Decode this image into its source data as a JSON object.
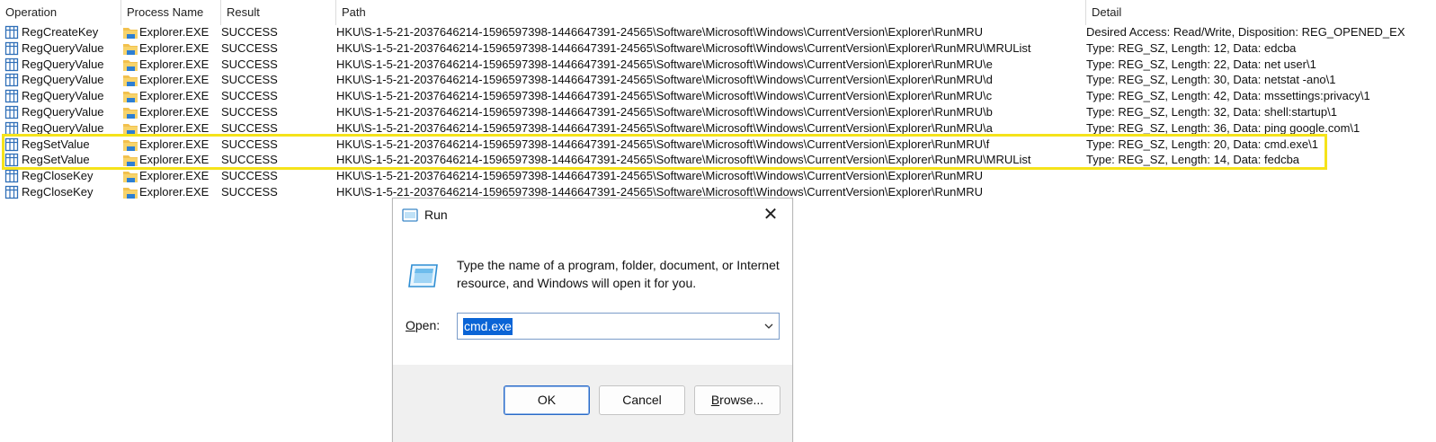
{
  "columns": {
    "operation": "Operation",
    "process_name": "Process Name",
    "result": "Result",
    "path": "Path",
    "detail": "Detail"
  },
  "rows": [
    {
      "operation": "RegCreateKey",
      "process": "Explorer.EXE",
      "result": "SUCCESS",
      "path": "HKU\\S-1-5-21-2037646214-1596597398-1446647391-24565\\Software\\Microsoft\\Windows\\CurrentVersion\\Explorer\\RunMRU",
      "detail": "Desired Access: Read/Write, Disposition: REG_OPENED_EX"
    },
    {
      "operation": "RegQueryValue",
      "process": "Explorer.EXE",
      "result": "SUCCESS",
      "path": "HKU\\S-1-5-21-2037646214-1596597398-1446647391-24565\\Software\\Microsoft\\Windows\\CurrentVersion\\Explorer\\RunMRU\\MRUList",
      "detail": "Type: REG_SZ, Length: 12, Data: edcba"
    },
    {
      "operation": "RegQueryValue",
      "process": "Explorer.EXE",
      "result": "SUCCESS",
      "path": "HKU\\S-1-5-21-2037646214-1596597398-1446647391-24565\\Software\\Microsoft\\Windows\\CurrentVersion\\Explorer\\RunMRU\\e",
      "detail": "Type: REG_SZ, Length: 22, Data: net user\\1"
    },
    {
      "operation": "RegQueryValue",
      "process": "Explorer.EXE",
      "result": "SUCCESS",
      "path": "HKU\\S-1-5-21-2037646214-1596597398-1446647391-24565\\Software\\Microsoft\\Windows\\CurrentVersion\\Explorer\\RunMRU\\d",
      "detail": "Type: REG_SZ, Length: 30, Data: netstat -ano\\1"
    },
    {
      "operation": "RegQueryValue",
      "process": "Explorer.EXE",
      "result": "SUCCESS",
      "path": "HKU\\S-1-5-21-2037646214-1596597398-1446647391-24565\\Software\\Microsoft\\Windows\\CurrentVersion\\Explorer\\RunMRU\\c",
      "detail": "Type: REG_SZ, Length: 42, Data: mssettings:privacy\\1"
    },
    {
      "operation": "RegQueryValue",
      "process": "Explorer.EXE",
      "result": "SUCCESS",
      "path": "HKU\\S-1-5-21-2037646214-1596597398-1446647391-24565\\Software\\Microsoft\\Windows\\CurrentVersion\\Explorer\\RunMRU\\b",
      "detail": "Type: REG_SZ, Length: 32, Data: shell:startup\\1"
    },
    {
      "operation": "RegQueryValue",
      "process": "Explorer.EXE",
      "result": "SUCCESS",
      "path": "HKU\\S-1-5-21-2037646214-1596597398-1446647391-24565\\Software\\Microsoft\\Windows\\CurrentVersion\\Explorer\\RunMRU\\a",
      "detail": "Type: REG_SZ, Length: 36, Data: ping google.com\\1"
    },
    {
      "operation": "RegSetValue",
      "process": "Explorer.EXE",
      "result": "SUCCESS",
      "path": "HKU\\S-1-5-21-2037646214-1596597398-1446647391-24565\\Software\\Microsoft\\Windows\\CurrentVersion\\Explorer\\RunMRU\\f",
      "detail": "Type: REG_SZ, Length: 20, Data: cmd.exe\\1"
    },
    {
      "operation": "RegSetValue",
      "process": "Explorer.EXE",
      "result": "SUCCESS",
      "path": "HKU\\S-1-5-21-2037646214-1596597398-1446647391-24565\\Software\\Microsoft\\Windows\\CurrentVersion\\Explorer\\RunMRU\\MRUList",
      "detail": "Type: REG_SZ, Length: 14, Data: fedcba"
    },
    {
      "operation": "RegCloseKey",
      "process": "Explorer.EXE",
      "result": "SUCCESS",
      "path": "HKU\\S-1-5-21-2037646214-1596597398-1446647391-24565\\Software\\Microsoft\\Windows\\CurrentVersion\\Explorer\\RunMRU",
      "detail": ""
    },
    {
      "operation": "RegCloseKey",
      "process": "Explorer.EXE",
      "result": "SUCCESS",
      "path": "HKU\\S-1-5-21-2037646214-1596597398-1446647391-24565\\Software\\Microsoft\\Windows\\CurrentVersion\\Explorer\\RunMRU",
      "detail": ""
    }
  ],
  "highlight_color": "#f5e31a",
  "run_dialog": {
    "title": "Run",
    "close_glyph": "✕",
    "description": "Type the name of a program, folder, document, or Internet resource, and Windows will open it for you.",
    "open_label_accel": "O",
    "open_label_rest": "pen:",
    "input_value": "cmd.exe",
    "ok_label": "OK",
    "cancel_label": "Cancel",
    "browse_label_accel": "B",
    "browse_label_rest": "rowse...",
    "selection_color": "#0a64d6",
    "accent_color": "#2a6ac7"
  }
}
